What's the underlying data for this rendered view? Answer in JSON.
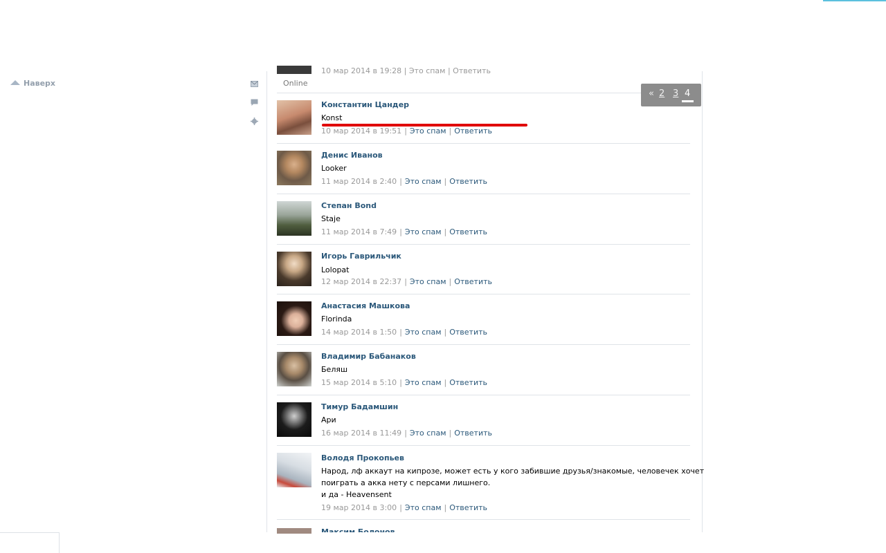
{
  "nav": {
    "to_top": "Наверх"
  },
  "pager": {
    "prev": "«",
    "pages": [
      "2",
      "3",
      "4"
    ]
  },
  "top_partial": {
    "meta_text": "10 мар 2014 в 19:28 | Это спам | Ответить",
    "status": "Online"
  },
  "actions": {
    "spam": "Это спам",
    "reply": "Ответить"
  },
  "comments": [
    {
      "name": "Константин Цандер",
      "text": [
        "Konst"
      ],
      "date": "10 мар 2014 в 19:51"
    },
    {
      "name": "Денис Иванов",
      "text": [
        "Looker"
      ],
      "date": "11 мар 2014 в 2:40"
    },
    {
      "name": "Степан Bond",
      "text": [
        "Staje"
      ],
      "date": "11 мар 2014 в 7:49"
    },
    {
      "name": "Игорь Гаврильчик",
      "text": [
        "Lolopat"
      ],
      "date": "12 мар 2014 в 22:37"
    },
    {
      "name": "Анастасия Машкова",
      "text": [
        "Florinda"
      ],
      "date": "14 мар 2014 в 1:50"
    },
    {
      "name": "Владимир Бабанаков",
      "text": [
        "Беляш"
      ],
      "date": "15 мар 2014 в 5:10"
    },
    {
      "name": "Тимур Бадамшин",
      "text": [
        "Ари"
      ],
      "date": "16 мар 2014 в 11:49"
    },
    {
      "name": "Володя Прокопьев",
      "text": [
        "Народ, лф аккаут на кипрозе, может есть у кого забившие друзья/знакомые, человечек хочет",
        "поиграть а акка нету с персами лишнего.",
        "и да - Heavensent"
      ],
      "date": "19 мар 2014 в 3:00"
    }
  ],
  "bottom_partial": {
    "name": "Максим Болонов"
  },
  "colors": {
    "link": "#2b587a",
    "meta": "#999999",
    "divider": "#dfe3e8",
    "highlight": "#e00000",
    "pager_bg": "#8c8c8c"
  }
}
